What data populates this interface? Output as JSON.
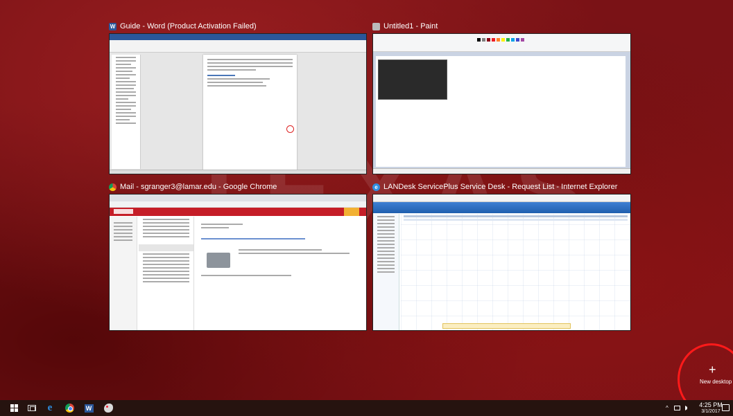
{
  "windows": {
    "word": {
      "title": "Guide - Word (Product Activation Failed)",
      "icon": "word-icon"
    },
    "paint": {
      "title": "Untitled1 - Paint",
      "icon": "paint-icon"
    },
    "chrome": {
      "title": "Mail - sgranger3@lamar.edu - Google Chrome",
      "icon": "chrome-icon"
    },
    "ie": {
      "title": "LANDesk ServicePlus Service Desk - Request List - Internet Explorer",
      "icon": "internet-explorer-icon"
    }
  },
  "new_desktop": {
    "plus": "+",
    "label": "New desktop"
  },
  "wallpaper_text": "TEXAS",
  "taskbar": {
    "tray_chevron": "^",
    "time": "4:25 PM",
    "date": "3/1/2017"
  },
  "colors": {
    "wallpaper": "#7a1216",
    "taskbar": "#26130f",
    "highlight_ring": "#ff1a1a",
    "word_blue": "#2b579a",
    "owa_red": "#c51d27"
  }
}
